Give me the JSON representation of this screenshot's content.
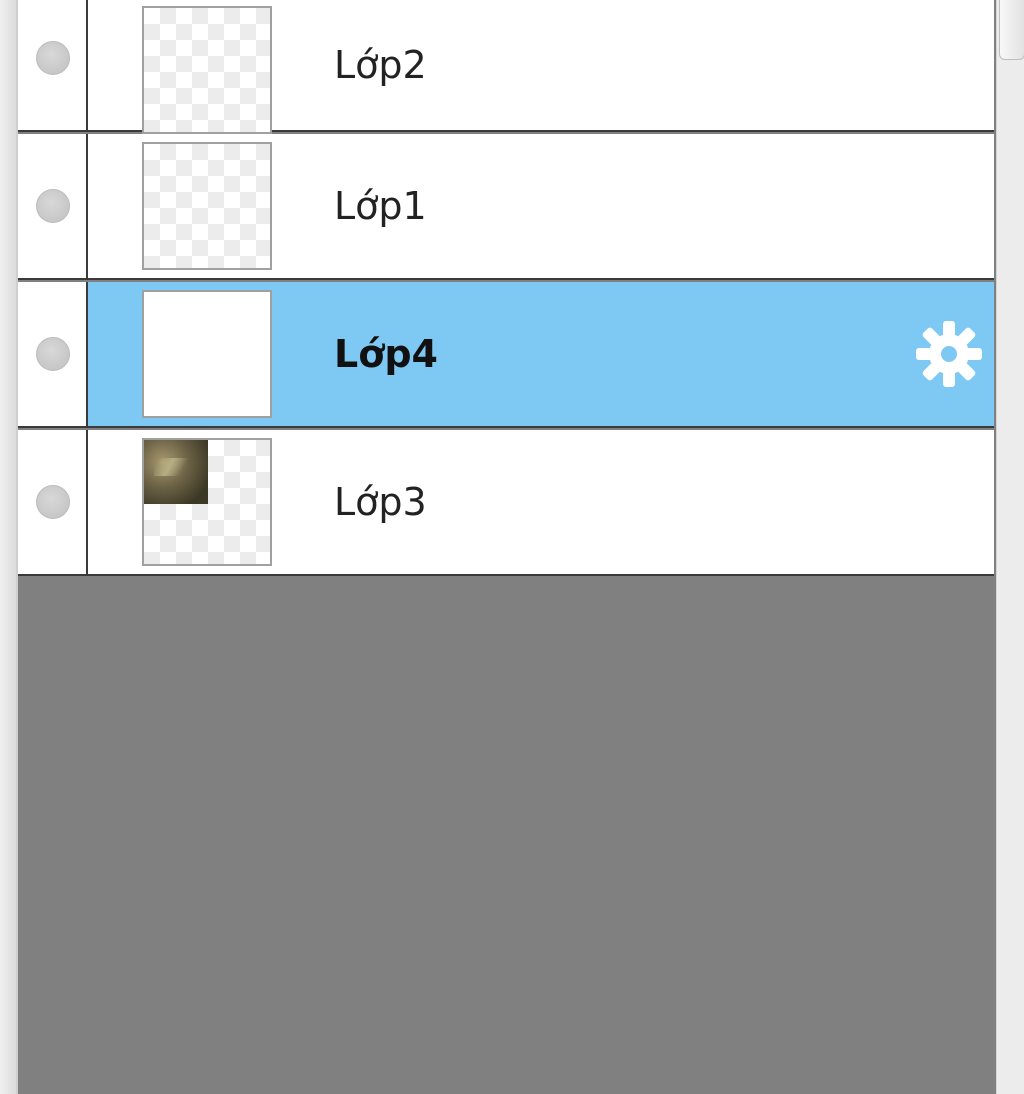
{
  "layers_panel": {
    "layers": [
      {
        "name": "Lớp2",
        "selected": false,
        "thumbnail": "transparent"
      },
      {
        "name": "Lớp1",
        "selected": false,
        "thumbnail": "transparent"
      },
      {
        "name": "Lớp4",
        "selected": true,
        "thumbnail": "white"
      },
      {
        "name": "Lớp3",
        "selected": false,
        "thumbnail": "image-corner"
      }
    ],
    "selected_color": "#7dc9f4",
    "empty_area_color": "#808080",
    "settings_icon": "gear-icon"
  }
}
